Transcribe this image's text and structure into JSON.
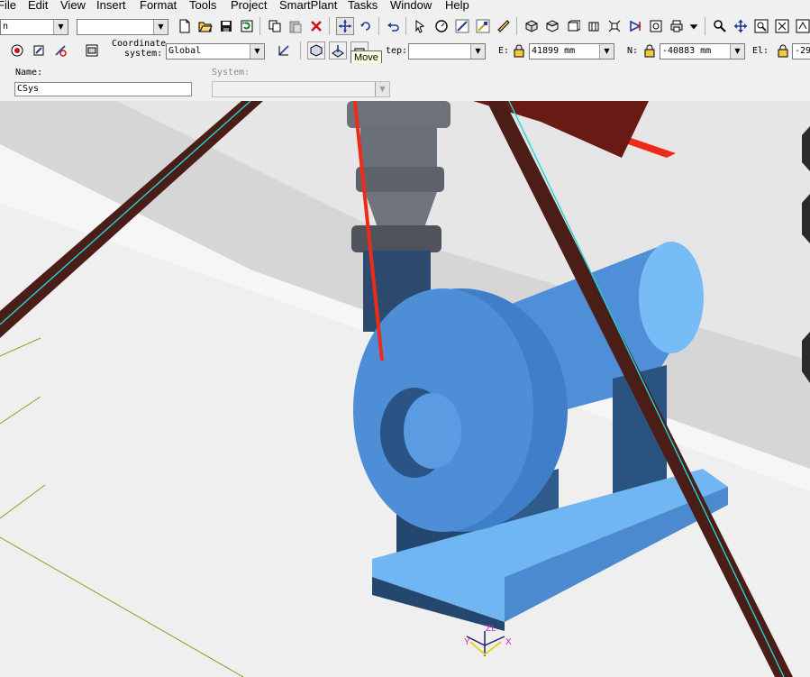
{
  "menu": {
    "items": [
      "File",
      "Edit",
      "View",
      "Insert",
      "Format",
      "Tools",
      "Project",
      "SmartPlant",
      "Tasks",
      "Window",
      "Help"
    ]
  },
  "toolbar": {
    "filter_combo_value": "n",
    "second_combo_value": "",
    "tooltip": "Move",
    "colors": {
      "red_icon": "#d01010",
      "blue_icon": "#1e3a9a",
      "green_icon": "#188018"
    }
  },
  "coordinates": {
    "coordinate_system_label_line1": "Coordinate",
    "coordinate_system_label_line2": "system:",
    "coordinate_system_value": "Global",
    "step_label": "tep:",
    "step_value": "",
    "e_label": "E:",
    "e_value": "41899 mm",
    "n_label": "N:",
    "n_value": "-40883 mm",
    "el_label": "El:",
    "el_value": "-29"
  },
  "properties": {
    "name_label": "Name:",
    "name_value": "CSys",
    "system_label": "System:",
    "system_value": ""
  },
  "viewport": {
    "axis_labels": {
      "x": "X",
      "y": "Y",
      "z": "ZL"
    },
    "colors": {
      "floor": "#ececec",
      "floor_dark": "#dcdcdc",
      "pump_light": "#74b8f5",
      "pump_mid": "#4e8ed6",
      "pump_dark": "#24476f",
      "pipe_gray": "#565a62",
      "beam": "#4a1d17",
      "cyan_line": "#21d4da",
      "arrow_red": "#ee2b1a"
    }
  }
}
